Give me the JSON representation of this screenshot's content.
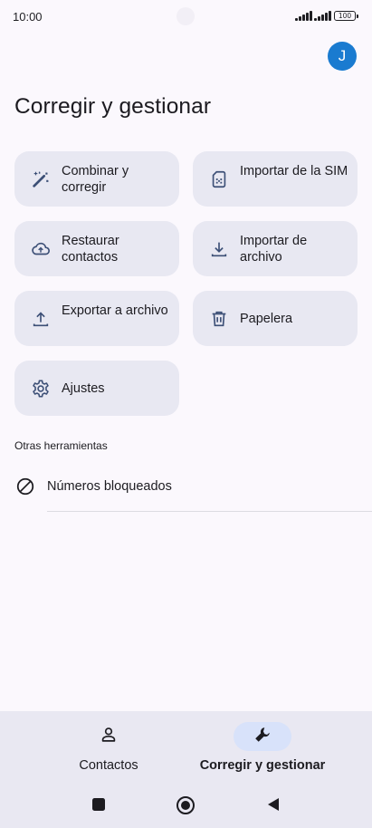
{
  "status_bar": {
    "time": "10:00",
    "battery": "100"
  },
  "account": {
    "avatar_initial": "J",
    "color": "#1a7bd0"
  },
  "page": {
    "title": "Corregir y gestionar"
  },
  "tiles": [
    {
      "label": "Combinar y corregir",
      "icon": "magic-wand-icon"
    },
    {
      "label": "Importar de la SIM",
      "icon": "sim-card-icon"
    },
    {
      "label": "Restaurar contactos",
      "icon": "cloud-restore-icon"
    },
    {
      "label": "Importar de archivo",
      "icon": "download-icon"
    },
    {
      "label": "Exportar a archivo",
      "icon": "upload-icon"
    },
    {
      "label": "Papelera",
      "icon": "trash-icon"
    },
    {
      "label": "Ajustes",
      "icon": "gear-icon"
    }
  ],
  "other_tools": {
    "heading": "Otras herramientas",
    "items": [
      {
        "label": "Números bloqueados",
        "icon": "block-icon"
      }
    ]
  },
  "bottom_nav": {
    "items": [
      {
        "label": "Contactos",
        "icon": "person-icon",
        "active": false
      },
      {
        "label": "Corregir y gestionar",
        "icon": "wrench-icon",
        "active": true
      }
    ]
  },
  "colors": {
    "tile_bg": "#e8e8f2",
    "icon_accent": "#3c4f76",
    "active_pill": "#d8e2fa"
  }
}
